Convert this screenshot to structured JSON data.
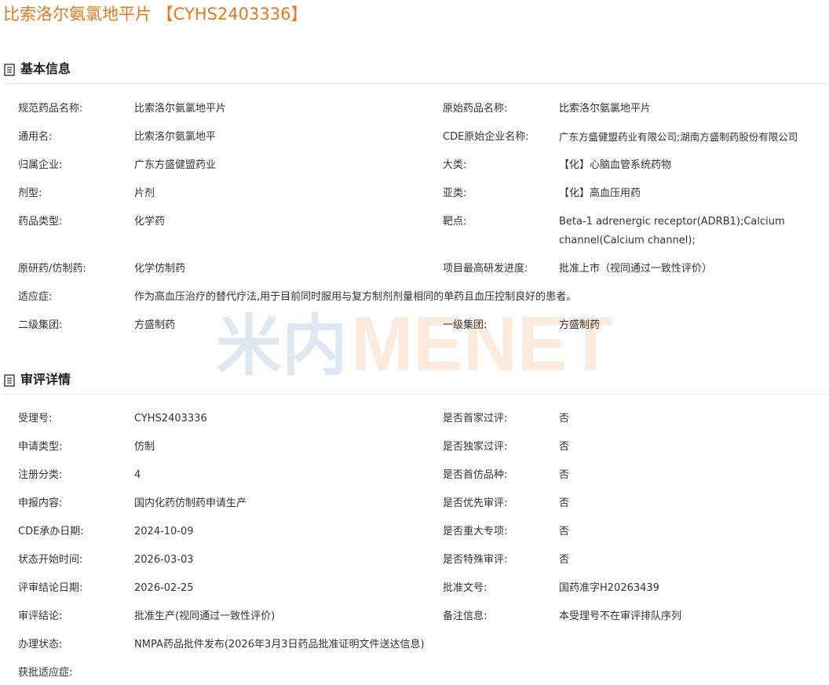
{
  "title": "比索洛尔氨氯地平片 【CYHS2403336】",
  "watermark": {
    "left_text": "米内",
    "right_text": "MENET"
  },
  "colors": {
    "accent": "#e6781e",
    "watermark_blue": "#3b78b5",
    "watermark_orange": "#f08a2c"
  },
  "basic": {
    "heading": "基本信息",
    "rows": [
      {
        "l_label": "规范药品名称:",
        "l_value": "比索洛尔氨氯地平片",
        "r_label": "原始药品名称:",
        "r_value": "比索洛尔氨氯地平片"
      },
      {
        "l_label": "通用名:",
        "l_value": "比索洛尔氨氯地平",
        "r_label": "CDE原始企业名称:",
        "r_value": "广东方盛健盟药业有限公司;湖南方盛制药股份有限公司"
      },
      {
        "l_label": "归属企业:",
        "l_value": "广东方盛健盟药业",
        "r_label": "大类:",
        "r_value": "【化】心脑血管系统药物"
      },
      {
        "l_label": "剂型:",
        "l_value": "片剂",
        "r_label": "亚类:",
        "r_value": "【化】高血压用药"
      },
      {
        "l_label": "药品类型:",
        "l_value": "化学药",
        "r_label": "靶点:",
        "r_value": "Beta-1 adrenergic receptor(ADRB1);Calcium channel(Calcium channel);"
      },
      {
        "l_label": "原研药/仿制药:",
        "l_value": "化学仿制药",
        "r_label": "项目最高研发进度:",
        "r_value": "批准上市（视同通过一致性评价）"
      },
      {
        "l_label": "适应症:",
        "l_value": "作为高血压治疗的替代疗法,用于目前同时服用与复方制剂剂量相同的单药且血压控制良好的患者。"
      },
      {
        "l_label": "二级集团:",
        "l_value": "方盛制药",
        "r_label": "一级集团:",
        "r_value": "方盛制药"
      }
    ]
  },
  "review": {
    "heading": "审评详情",
    "rows": [
      {
        "l_label": "受理号:",
        "l_value": "CYHS2403336",
        "r_label": "是否首家过评:",
        "r_value": "否"
      },
      {
        "l_label": "申请类型:",
        "l_value": "仿制",
        "r_label": "是否独家过评:",
        "r_value": "否"
      },
      {
        "l_label": "注册分类:",
        "l_value": "4",
        "r_label": "是否首仿品种:",
        "r_value": "否"
      },
      {
        "l_label": "申报内容:",
        "l_value": "国内化药仿制药申请生产",
        "r_label": "是否优先审评:",
        "r_value": "否"
      },
      {
        "l_label": "CDE承办日期:",
        "l_value": "2024-10-09",
        "r_label": "是否重大专项:",
        "r_value": "否"
      },
      {
        "l_label": "状态开始时间:",
        "l_value": "2026-03-03",
        "r_label": "是否特殊审评:",
        "r_value": "否"
      },
      {
        "l_label": "评审结论日期:",
        "l_value": "2026-02-25",
        "r_label": "批准文号:",
        "r_value": "国药准字H20263439"
      },
      {
        "l_label": "审评结论:",
        "l_value": "批准生产(视同通过一致性评价)",
        "r_label": "备注信息:",
        "r_value": "本受理号不在审评排队序列"
      },
      {
        "l_label": "办理状态:",
        "l_value": "NMPA药品批件发布(2026年3月3日药品批准证明文件送达信息)"
      },
      {
        "l_label": "获批适应症:",
        "l_value": ""
      }
    ]
  }
}
